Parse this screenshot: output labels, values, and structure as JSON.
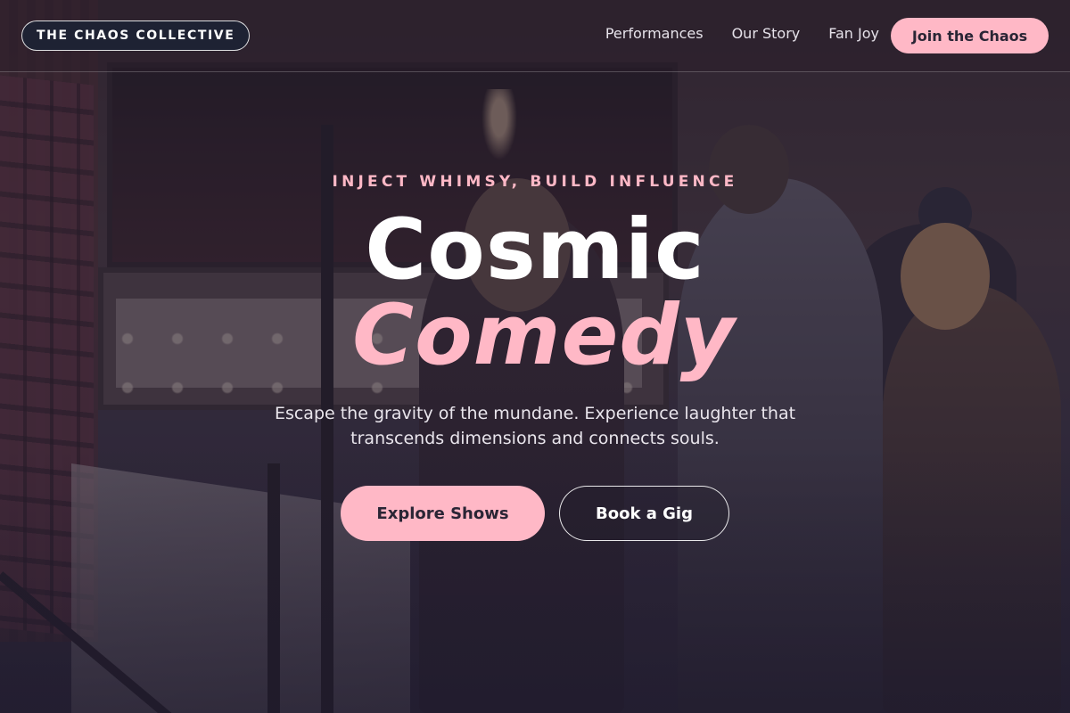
{
  "header": {
    "brand": "THE CHAOS COLLECTIVE",
    "nav": [
      {
        "label": "Performances"
      },
      {
        "label": "Our Story"
      },
      {
        "label": "Fan Joy"
      }
    ],
    "cta_label": "Join the Chaos"
  },
  "hero": {
    "eyebrow": "INJECT WHIMSY, BUILD INFLUENCE",
    "title_line1": "Cosmic",
    "title_line2": "Comedy",
    "tagline": "Escape the gravity of the mundane. Experience laughter that transcends dimensions and connects souls.",
    "primary_button": "Explore Shows",
    "secondary_button": "Book a Gig"
  },
  "theme": {
    "accent": "#ffb8c6",
    "brand_pill_bg": "#1e2233",
    "text_light": "#ffffff"
  }
}
